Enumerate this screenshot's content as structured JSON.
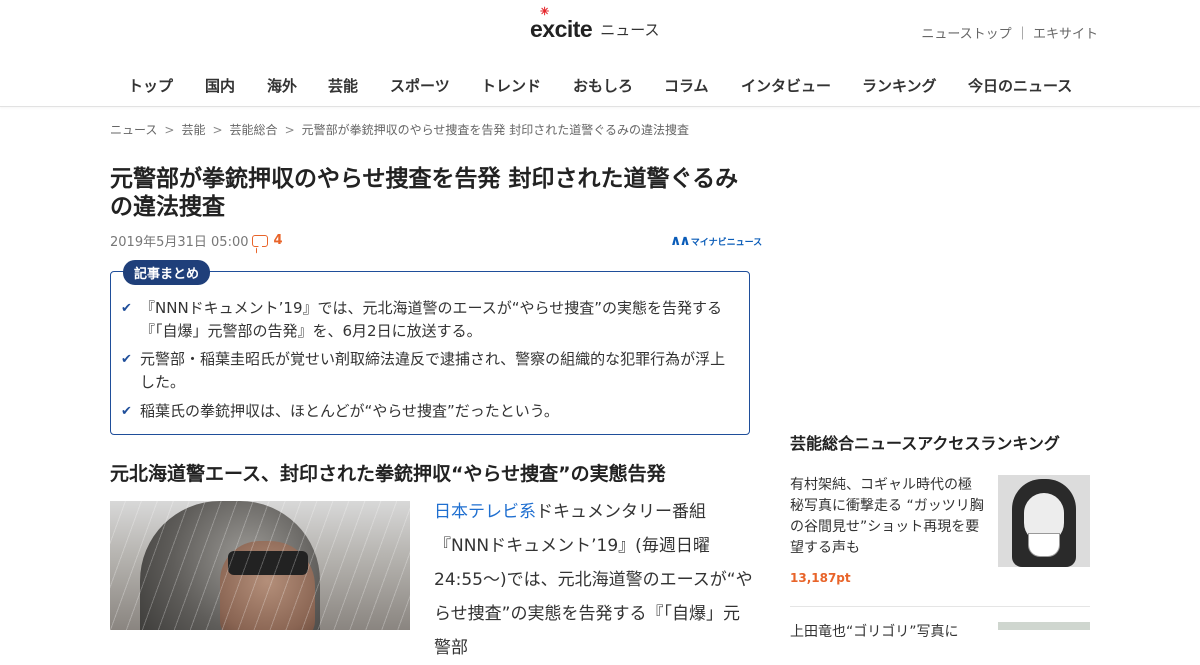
{
  "header": {
    "logo_text": "excite",
    "logo_section": "ニュース",
    "links": [
      "ニューストップ",
      "エキサイト"
    ],
    "link_separator": "｜",
    "nav": [
      "トップ",
      "国内",
      "海外",
      "芸能",
      "スポーツ",
      "トレンド",
      "おもしろ",
      "コラム",
      "インタビュー",
      "ランキング",
      "今日のニュース"
    ]
  },
  "breadcrumb": {
    "items": [
      "ニュース",
      "芸能",
      "芸能総合",
      "元警部が拳銃押収のやらせ捜査を告発 封印された道警ぐるみの違法捜査"
    ],
    "separator": ">"
  },
  "article": {
    "title": "元警部が拳銃押収のやらせ捜査を告発 封印された道警ぐるみの違法捜査",
    "date": "2019年5月31日 05:00",
    "comment_count": "4",
    "source_mark": "∧∧",
    "source_name": "マイナビニュース",
    "summary_label": "記事まとめ",
    "summary": [
      "『NNNドキュメント’19』では、元北海道警のエースが“やらせ捜査”の実態を告発する『「自爆」元警部の告発』を、6月2日に放送する。",
      "元警部・稲葉圭昭氏が覚せい剤取締法違反で逮捕され、警察の組織的な犯罪行為が浮上した。",
      "稲葉氏の拳銃押収は、ほとんどが“やらせ捜査”だったという。"
    ],
    "section_heading": "元北海道警エース、封印された拳銃押収“やらせ捜査”の実態告発",
    "body_link": "日本テレビ系",
    "body_text": "ドキュメンタリー番組『NNNドキュメント’19』(毎週日曜24:55～)では、元北海道警のエースが“やらせ捜査”の実態を告発する『「自爆」元警部"
  },
  "sidebar": {
    "ranking_title": "芸能総合ニュースアクセスランキング",
    "ranking": [
      {
        "title": "有村架純、コギャル時代の極秘写真に衝撃走る “ガッツリ胸の谷間見せ”ショット再現を要望する声も",
        "points": "13,187pt"
      },
      {
        "title": "上田竜也“ゴリゴリ”写真に",
        "points": ""
      }
    ]
  }
}
